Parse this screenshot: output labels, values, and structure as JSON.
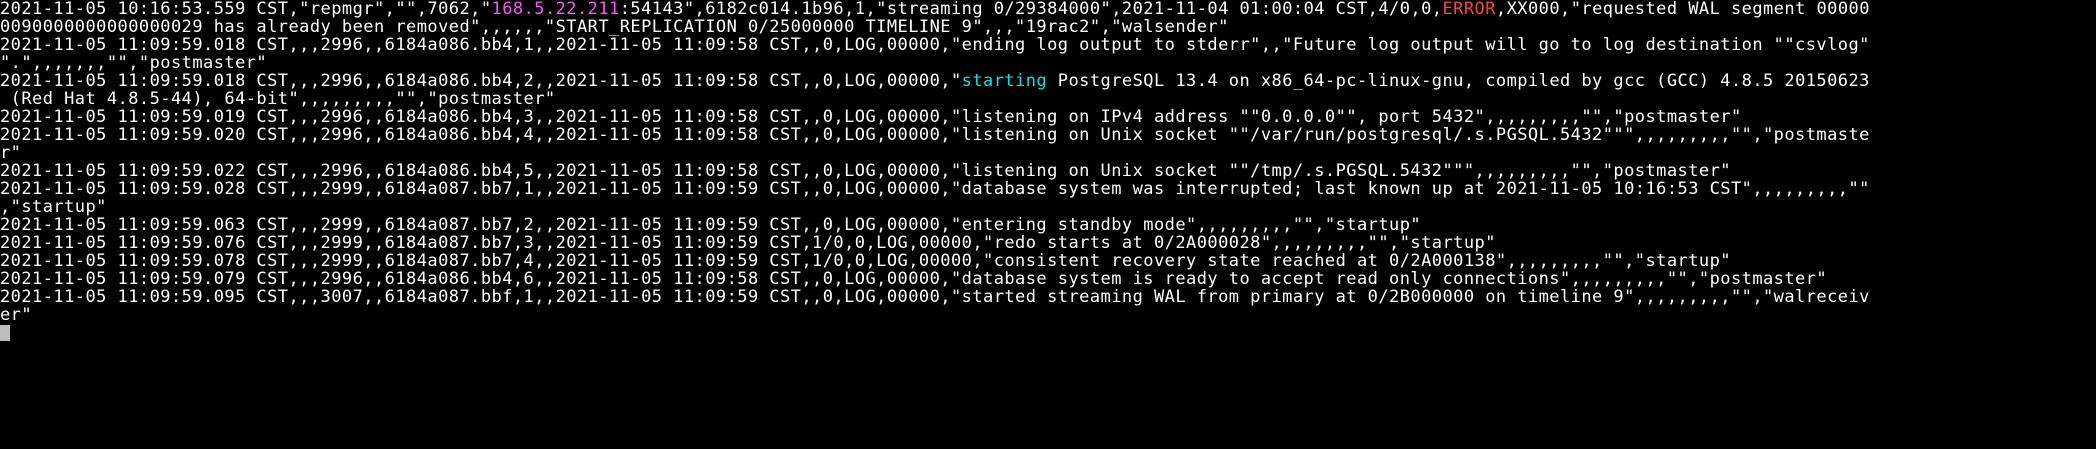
{
  "colors": {
    "background": "#000000",
    "text": "#ffffff",
    "ip_highlight": "#ff4fff",
    "error_highlight": "#ff3b3b",
    "starting_highlight": "#00e5e5",
    "cursor": "#bdbdbd"
  },
  "terminal": {
    "lines": [
      {
        "segments": [
          {
            "text": "2021-11-05 10:16:53.559 CST,\"repmgr\",\"\",7062,\"",
            "style": "normal"
          },
          {
            "text": "168.5.22.211",
            "style": "magenta"
          },
          {
            "text": ":54143\",6182c014.1b96,1,\"streaming 0/29384000\",2021-11-04 01:00:04 CST,4/0,0,",
            "style": "normal"
          },
          {
            "text": "ERROR",
            "style": "red"
          },
          {
            "text": ",XX000,\"requested WAL segment 00000",
            "style": "normal"
          }
        ]
      },
      {
        "segments": [
          {
            "text": "0090000000000000029 has already been removed\",,,,,,\"START_REPLICATION 0/25000000 TIMELINE 9\",,,\"19rac2\",\"walsender\"",
            "style": "normal"
          }
        ]
      },
      {
        "segments": [
          {
            "text": "2021-11-05 11:09:59.018 CST,,,2996,,6184a086.bb4,1,,2021-11-05 11:09:58 CST,,0,LOG,00000,\"ending log output to stderr\",,\"Future log output will go to log destination \"\"csvlog\"",
            "style": "normal"
          }
        ]
      },
      {
        "segments": [
          {
            "text": "\".\",,,,,,,\"\",\"postmaster\"",
            "style": "normal"
          }
        ]
      },
      {
        "segments": [
          {
            "text": "2021-11-05 11:09:59.018 CST,,,2996,,6184a086.bb4,2,,2021-11-05 11:09:58 CST,,0,LOG,00000,\"",
            "style": "normal"
          },
          {
            "text": "starting",
            "style": "cyan"
          },
          {
            "text": " PostgreSQL 13.4 on x86_64-pc-linux-gnu, compiled by gcc (GCC) 4.8.5 20150623",
            "style": "normal"
          }
        ]
      },
      {
        "segments": [
          {
            "text": " (Red Hat 4.8.5-44), 64-bit\",,,,,,,,,\"\",\"postmaster\"",
            "style": "normal"
          }
        ]
      },
      {
        "segments": [
          {
            "text": "2021-11-05 11:09:59.019 CST,,,2996,,6184a086.bb4,3,,2021-11-05 11:09:58 CST,,0,LOG,00000,\"listening on IPv4 address \"\"0.0.0.0\"\", port 5432\",,,,,,,,,\"\",\"postmaster\"",
            "style": "normal"
          }
        ]
      },
      {
        "segments": [
          {
            "text": "2021-11-05 11:09:59.020 CST,,,2996,,6184a086.bb4,4,,2021-11-05 11:09:58 CST,,0,LOG,00000,\"listening on Unix socket \"\"/var/run/postgresql/.s.PGSQL.5432\"\"\",,,,,,,,,\"\",\"postmaste",
            "style": "normal"
          }
        ]
      },
      {
        "segments": [
          {
            "text": "r\"",
            "style": "normal"
          }
        ]
      },
      {
        "segments": [
          {
            "text": "2021-11-05 11:09:59.022 CST,,,2996,,6184a086.bb4,5,,2021-11-05 11:09:58 CST,,0,LOG,00000,\"listening on Unix socket \"\"/tmp/.s.PGSQL.5432\"\"\",,,,,,,,,\"\",\"postmaster\"",
            "style": "normal"
          }
        ]
      },
      {
        "segments": [
          {
            "text": "2021-11-05 11:09:59.028 CST,,,2999,,6184a087.bb7,1,,2021-11-05 11:09:59 CST,,0,LOG,00000,\"database system was interrupted; last known up at 2021-11-05 10:16:53 CST\",,,,,,,,,\"\"",
            "style": "normal"
          }
        ]
      },
      {
        "segments": [
          {
            "text": ",\"startup\"",
            "style": "normal"
          }
        ]
      },
      {
        "segments": [
          {
            "text": "2021-11-05 11:09:59.063 CST,,,2999,,6184a087.bb7,2,,2021-11-05 11:09:59 CST,,0,LOG,00000,\"entering standby mode\",,,,,,,,,\"\",\"startup\"",
            "style": "normal"
          }
        ]
      },
      {
        "segments": [
          {
            "text": "2021-11-05 11:09:59.076 CST,,,2999,,6184a087.bb7,3,,2021-11-05 11:09:59 CST,1/0,0,LOG,00000,\"redo starts at 0/2A000028\",,,,,,,,,\"\",\"startup\"",
            "style": "normal"
          }
        ]
      },
      {
        "segments": [
          {
            "text": "2021-11-05 11:09:59.078 CST,,,2999,,6184a087.bb7,4,,2021-11-05 11:09:59 CST,1/0,0,LOG,00000,\"consistent recovery state reached at 0/2A000138\",,,,,,,,,\"\",\"startup\"",
            "style": "normal"
          }
        ]
      },
      {
        "segments": [
          {
            "text": "2021-11-05 11:09:59.079 CST,,,2996,,6184a086.bb4,6,,2021-11-05 11:09:58 CST,,0,LOG,00000,\"database system is ready to accept read only connections\",,,,,,,,,\"\",\"postmaster\"",
            "style": "normal"
          }
        ]
      },
      {
        "segments": [
          {
            "text": "2021-11-05 11:09:59.095 CST,,,3007,,6184a087.bbf,1,,2021-11-05 11:09:59 CST,,0,LOG,00000,\"started streaming WAL from primary at 0/2B000000 on timeline 9\",,,,,,,,,\"\",\"walreceiv",
            "style": "normal"
          }
        ]
      },
      {
        "segments": [
          {
            "text": "er\"",
            "style": "normal"
          }
        ]
      },
      {
        "segments": []
      }
    ]
  }
}
